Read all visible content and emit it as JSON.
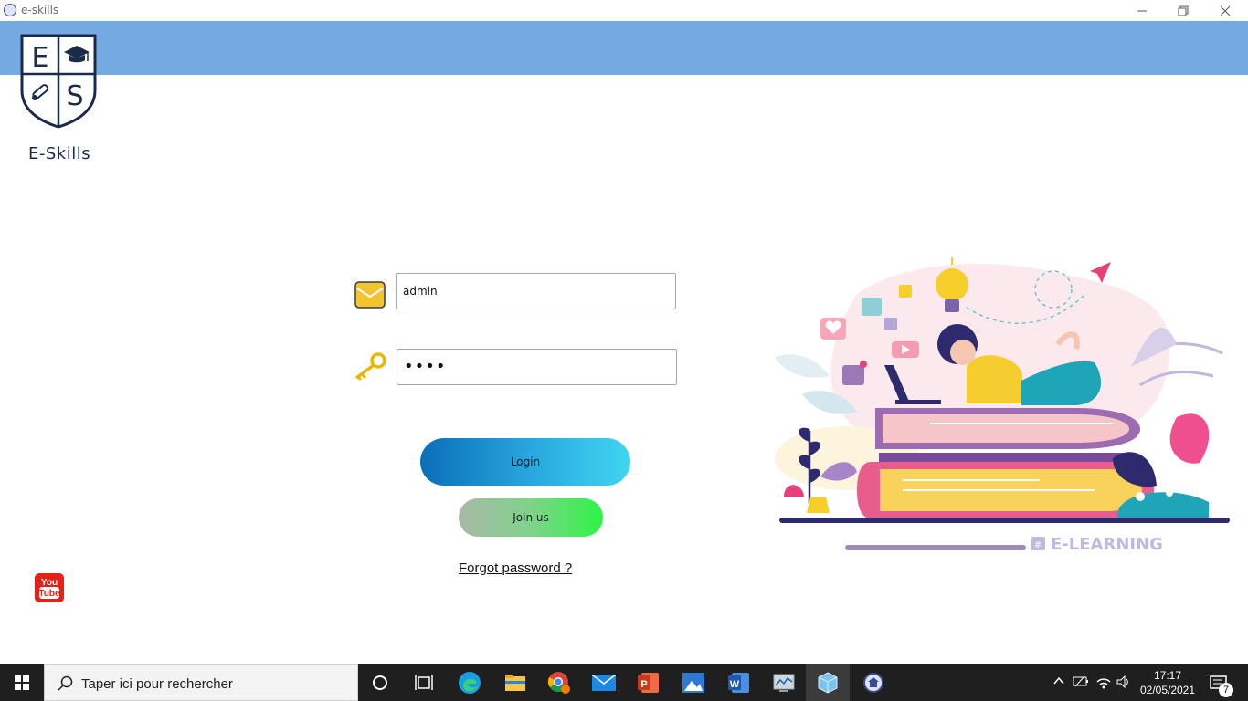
{
  "window": {
    "title": "e-skills"
  },
  "brand": {
    "name": "E-Skills",
    "logo_letters": [
      "E",
      "S"
    ]
  },
  "form": {
    "email_value": "admin",
    "password_value": "••••",
    "login_label": "Login",
    "join_label": "Join us",
    "forgot_label": "Forgot password ?"
  },
  "illustration": {
    "caption": "E-LEARNING"
  },
  "taskbar": {
    "search_placeholder": "Taper ici pour rechercher",
    "time": "17:17",
    "date": "02/05/2021",
    "notification_count": "7",
    "apps": [
      "cortana",
      "task-view",
      "edge",
      "file-explorer",
      "chrome",
      "mail",
      "powerpoint",
      "photos",
      "word",
      "system-tool",
      "app-cube",
      "e-skills"
    ]
  },
  "colors": {
    "header": "#75a9e1",
    "taskbar": "#1f1f1f",
    "logo_navy": "#1a2b4a"
  }
}
